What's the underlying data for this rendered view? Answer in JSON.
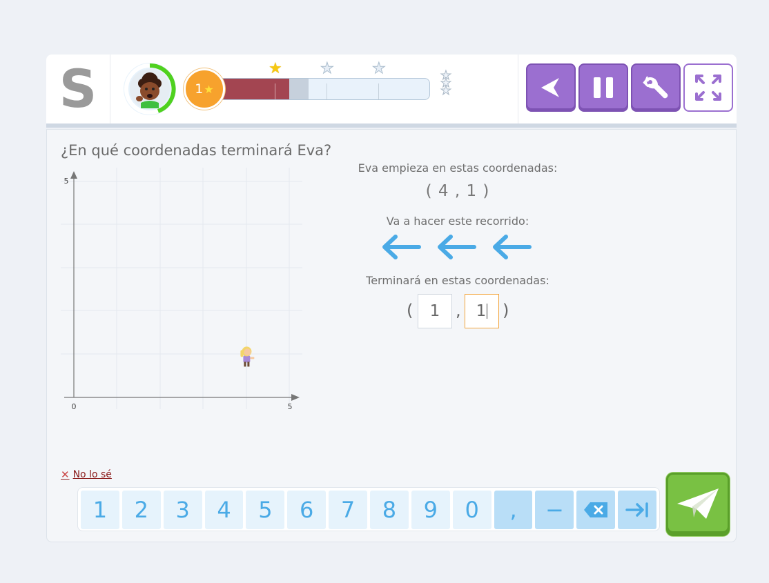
{
  "header": {
    "logo_letter": "S",
    "level": {
      "number": "1",
      "star": "★"
    },
    "progress": {
      "filled_fraction": 0.33,
      "stars": [
        "earned",
        "empty",
        "empty"
      ]
    },
    "controls": [
      {
        "name": "back-button",
        "icon": "back-arrow-icon"
      },
      {
        "name": "pause-button",
        "icon": "pause-icon"
      },
      {
        "name": "settings-button",
        "icon": "wrench-icon"
      },
      {
        "name": "fullscreen-button",
        "icon": "expand-icon"
      }
    ]
  },
  "question": "¿En qué coordenadas terminará Eva?",
  "graph": {
    "x_origin_label": "0",
    "x_max_label": "5",
    "y_max_label": "5",
    "character": {
      "name": "Eva",
      "x": 4,
      "y": 1
    }
  },
  "start": {
    "label": "Eva empieza en estas coordenadas:",
    "coords": "( 4 , 1 )"
  },
  "route": {
    "label": "Va a hacer este recorrido:",
    "arrows": [
      "left",
      "left",
      "left"
    ],
    "arrow_color": "#4aaae6"
  },
  "end": {
    "label": "Terminará en estas coordenadas:",
    "open_paren": "(",
    "comma": ",",
    "close_paren": ")",
    "x_value": "1",
    "y_value": "1"
  },
  "dont_know": "No lo sé",
  "keypad": {
    "digits": [
      "1",
      "2",
      "3",
      "4",
      "5",
      "6",
      "7",
      "8",
      "9",
      "0"
    ],
    "comma": ",",
    "minus": "−"
  },
  "colors": {
    "purple_button": "#9b6fd0",
    "progress_fill": "#a34551",
    "level_badge": "#f7a22d",
    "send_button": "#79c143",
    "key_text": "#4aaae6"
  }
}
